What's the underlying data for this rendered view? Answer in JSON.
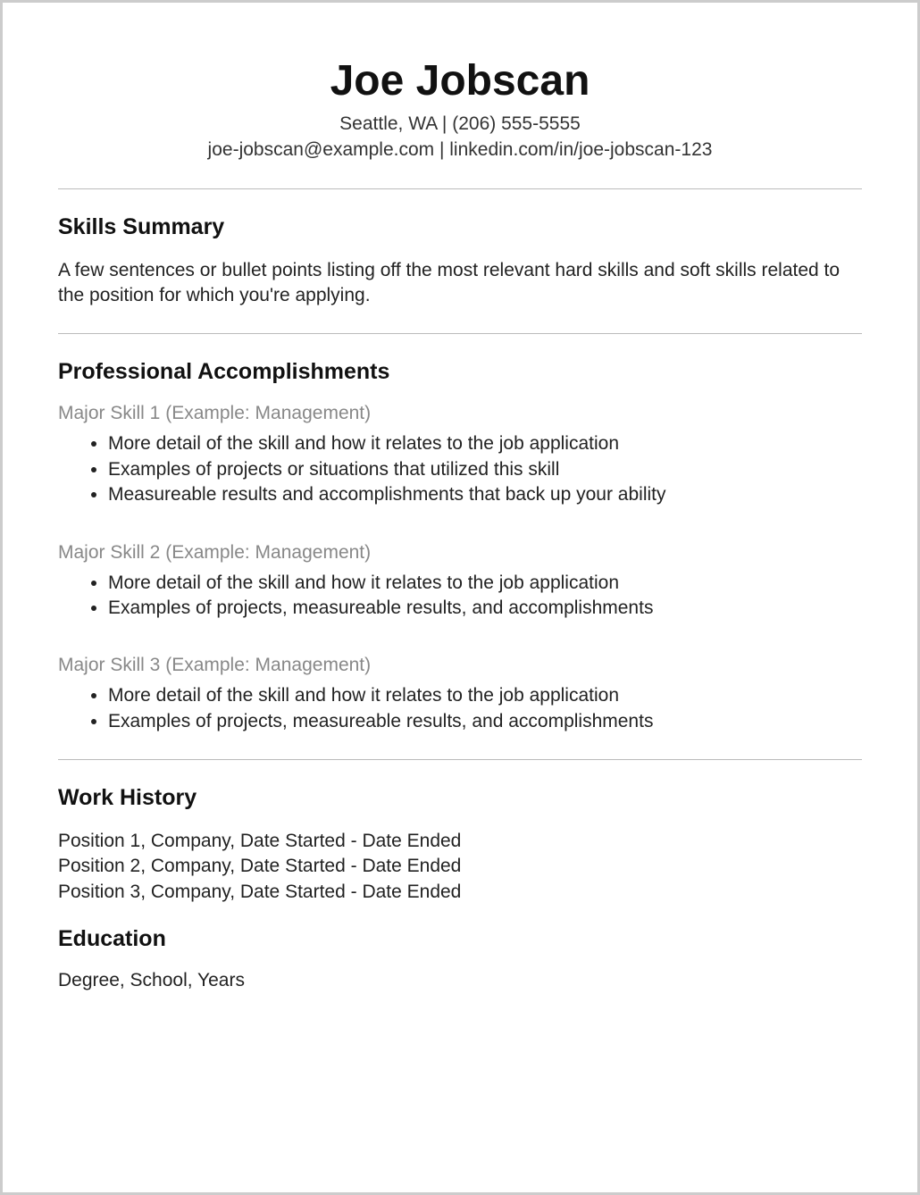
{
  "header": {
    "name": "Joe Jobscan",
    "contact_line1": "Seattle, WA | (206) 555-5555",
    "contact_line2": "joe-jobscan@example.com | linkedin.com/in/joe-jobscan-123"
  },
  "skills_summary": {
    "title": "Skills Summary",
    "body": "A few sentences or bullet points listing off the most relevant hard skills and soft skills related to the position for which you're applying."
  },
  "accomplishments": {
    "title": "Professional Accomplishments",
    "skills": [
      {
        "heading": "Major Skill 1 (Example: Management)",
        "bullets": [
          "More detail of the skill and how it relates to the job application",
          "Examples of projects or situations that utilized this skill",
          "Measureable results and accomplishments that back up your ability"
        ]
      },
      {
        "heading": "Major Skill 2 (Example: Management)",
        "bullets": [
          "More detail of the skill and how it relates to the job application",
          "Examples of projects, measureable results, and accomplishments"
        ]
      },
      {
        "heading": "Major Skill 3 (Example: Management)",
        "bullets": [
          "More detail of the skill and how it relates to the job application",
          "Examples of projects, measureable results, and accomplishments"
        ]
      }
    ]
  },
  "work_history": {
    "title": "Work History",
    "positions": [
      "Position 1, Company, Date Started - Date Ended",
      "Position 2, Company, Date Started - Date Ended",
      "Position 3, Company, Date Started - Date Ended"
    ]
  },
  "education": {
    "title": "Education",
    "body": "Degree, School, Years"
  }
}
